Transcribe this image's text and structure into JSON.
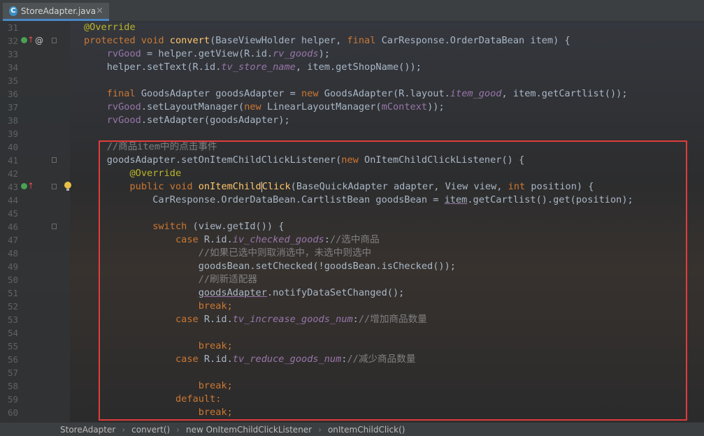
{
  "tab": {
    "icon": "C",
    "title": "StoreAdapter.java",
    "close": "×"
  },
  "breadcrumb": [
    "StoreAdapter",
    "convert()",
    "new OnItemChildClickListener",
    "onItemChildClick()"
  ],
  "lines": [
    {
      "n": "31",
      "markers": [],
      "tokens": [
        [
          "ann",
          "@Override"
        ]
      ]
    },
    {
      "n": "32",
      "markers": [
        "green",
        "up",
        "at",
        "fold"
      ],
      "tokens": [
        [
          "kw",
          "protected void "
        ],
        [
          "fn",
          "convert"
        ],
        [
          "",
          "(BaseViewHolder helper, "
        ],
        [
          "kw",
          "final "
        ],
        [
          "",
          "CarResponse.OrderDataBean item) {"
        ]
      ]
    },
    {
      "n": "33",
      "markers": [],
      "tokens": [
        [
          "",
          "    "
        ],
        [
          "fld",
          "rvGood"
        ],
        [
          "",
          " = helper.getView(R.id."
        ],
        [
          "fldi",
          "rv_goods"
        ],
        [
          "",
          ");"
        ]
      ]
    },
    {
      "n": "34",
      "markers": [],
      "tokens": [
        [
          "",
          "    helper.setText(R.id."
        ],
        [
          "fldi",
          "tv_store_name"
        ],
        [
          "",
          ", item.getShopName());"
        ]
      ]
    },
    {
      "n": "35",
      "markers": [],
      "tokens": []
    },
    {
      "n": "36",
      "markers": [],
      "tokens": [
        [
          "",
          "    "
        ],
        [
          "kw",
          "final "
        ],
        [
          "",
          "GoodsAdapter goodsAdapter = "
        ],
        [
          "kw",
          "new "
        ],
        [
          "",
          "GoodsAdapter(R.layout."
        ],
        [
          "fldi",
          "item_good"
        ],
        [
          "",
          ", item.getCartlist());"
        ]
      ]
    },
    {
      "n": "37",
      "markers": [],
      "tokens": [
        [
          "",
          "    "
        ],
        [
          "fld",
          "rvGood"
        ],
        [
          "",
          ".setLayoutManager("
        ],
        [
          "kw",
          "new "
        ],
        [
          "",
          "LinearLayoutManager("
        ],
        [
          "fld",
          "mContext"
        ],
        [
          "",
          "));"
        ]
      ]
    },
    {
      "n": "38",
      "markers": [],
      "tokens": [
        [
          "",
          "    "
        ],
        [
          "fld",
          "rvGood"
        ],
        [
          "",
          ".setAdapter(goodsAdapter);"
        ]
      ]
    },
    {
      "n": "39",
      "markers": [],
      "tokens": []
    },
    {
      "n": "40",
      "markers": [],
      "tokens": [
        [
          "cm",
          "    //商品item中的点击事件"
        ]
      ]
    },
    {
      "n": "41",
      "markers": [
        "fold"
      ],
      "tokens": [
        [
          "",
          "    goodsAdapter.setOnItemChildClickListener("
        ],
        [
          "kw",
          "new "
        ],
        [
          "",
          "OnItemChildClickListener() {"
        ]
      ]
    },
    {
      "n": "42",
      "markers": [],
      "tokens": [
        [
          "",
          "        "
        ],
        [
          "ann",
          "@Override"
        ]
      ]
    },
    {
      "n": "43",
      "markers": [
        "green",
        "up",
        "fold",
        "bulb"
      ],
      "tokens": [
        [
          "",
          "        "
        ],
        [
          "kw",
          "public void "
        ],
        [
          "fn",
          "onItemChild"
        ],
        [
          "caret",
          ""
        ],
        [
          "fn",
          "Click"
        ],
        [
          "",
          "(BaseQuickAdapter adapter, View view, "
        ],
        [
          "kw",
          "int "
        ],
        [
          "",
          "position) {"
        ]
      ]
    },
    {
      "n": "44",
      "markers": [],
      "tokens": [
        [
          "",
          "            CarResponse.OrderDataBean.CartlistBean goodsBean = "
        ],
        [
          "ul",
          "item"
        ],
        [
          "",
          ".getCartlist().get(position);"
        ]
      ]
    },
    {
      "n": "45",
      "markers": [],
      "tokens": []
    },
    {
      "n": "46",
      "markers": [
        "fold"
      ],
      "tokens": [
        [
          "",
          "            "
        ],
        [
          "kw",
          "switch "
        ],
        [
          "",
          "(view.getId()) {"
        ]
      ]
    },
    {
      "n": "47",
      "markers": [],
      "tokens": [
        [
          "",
          "                "
        ],
        [
          "kw",
          "case "
        ],
        [
          "",
          "R.id."
        ],
        [
          "fldi",
          "iv_checked_goods"
        ],
        [
          "",
          ":"
        ],
        [
          "cm",
          "//选中商品"
        ]
      ]
    },
    {
      "n": "48",
      "markers": [],
      "tokens": [
        [
          "cm",
          "                    //如果已选中则取消选中，未选中则选中"
        ]
      ]
    },
    {
      "n": "49",
      "markers": [],
      "tokens": [
        [
          "",
          "                    goodsBean.setChecked(!goodsBean.isChecked());"
        ]
      ]
    },
    {
      "n": "50",
      "markers": [],
      "tokens": [
        [
          "cm",
          "                    //刷新适配器"
        ]
      ]
    },
    {
      "n": "51",
      "markers": [],
      "tokens": [
        [
          "",
          "                    "
        ],
        [
          "ul",
          "goodsAdapter"
        ],
        [
          "",
          ".notifyDataSetChanged();"
        ]
      ]
    },
    {
      "n": "52",
      "markers": [],
      "tokens": [
        [
          "",
          "                    "
        ],
        [
          "kw",
          "break;"
        ]
      ]
    },
    {
      "n": "53",
      "markers": [],
      "tokens": [
        [
          "",
          "                "
        ],
        [
          "kw",
          "case "
        ],
        [
          "",
          "R.id."
        ],
        [
          "fldi",
          "tv_increase_goods_num"
        ],
        [
          "",
          ":"
        ],
        [
          "cm",
          "//增加商品数量"
        ]
      ]
    },
    {
      "n": "54",
      "markers": [],
      "tokens": []
    },
    {
      "n": "55",
      "markers": [],
      "tokens": [
        [
          "",
          "                    "
        ],
        [
          "kw",
          "break;"
        ]
      ]
    },
    {
      "n": "56",
      "markers": [],
      "tokens": [
        [
          "",
          "                "
        ],
        [
          "kw",
          "case "
        ],
        [
          "",
          "R.id."
        ],
        [
          "fldi",
          "tv_reduce_goods_num"
        ],
        [
          "",
          ":"
        ],
        [
          "cm",
          "//减少商品数量"
        ]
      ]
    },
    {
      "n": "57",
      "markers": [],
      "tokens": []
    },
    {
      "n": "58",
      "markers": [],
      "tokens": [
        [
          "",
          "                    "
        ],
        [
          "kw",
          "break;"
        ]
      ]
    },
    {
      "n": "59",
      "markers": [],
      "tokens": [
        [
          "",
          "                "
        ],
        [
          "kw",
          "default:"
        ]
      ]
    },
    {
      "n": "60",
      "markers": [],
      "tokens": [
        [
          "",
          "                    "
        ],
        [
          "kw",
          "break;"
        ]
      ]
    }
  ]
}
